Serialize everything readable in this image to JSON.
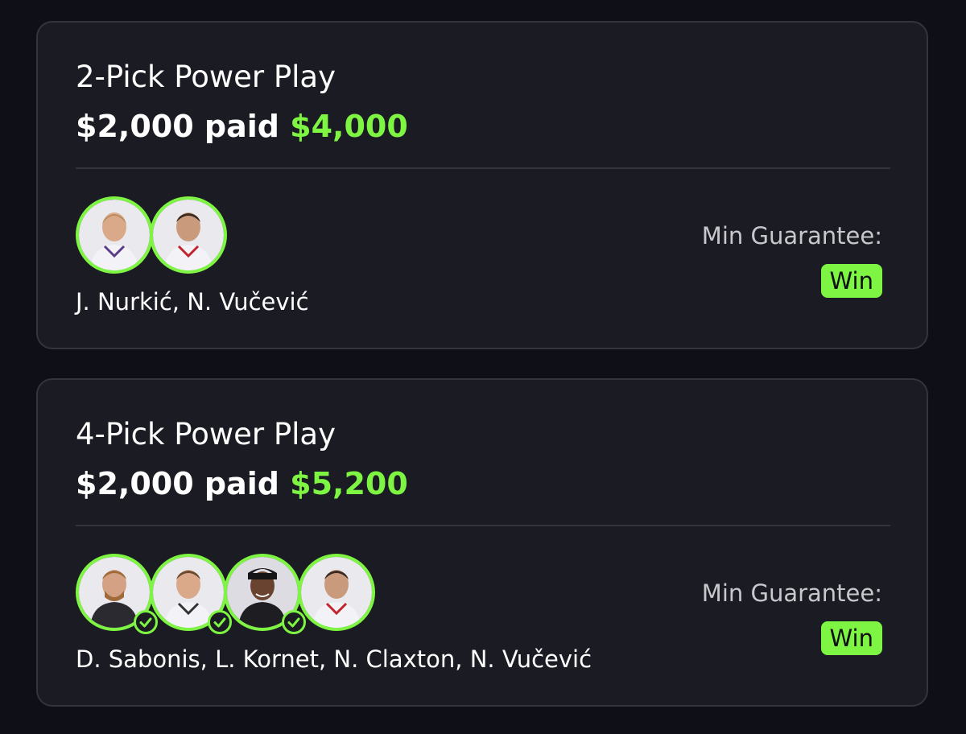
{
  "colors": {
    "accent": "#7ef542",
    "card_bg": "#1b1b23",
    "page_bg": "#0f0f18"
  },
  "cards": [
    {
      "title": "2-Pick Power Play",
      "paid_amount": "$2,000 paid",
      "payout": "$4,000",
      "players_text": "J. Nurkić, N. Vučević",
      "min_guarantee_label": "Min Guarantee:",
      "min_guarantee_value": "Win",
      "avatars": [
        {
          "icon": "player-headshot-icon",
          "checked": false
        },
        {
          "icon": "player-headshot-icon",
          "checked": false
        }
      ]
    },
    {
      "title": "4-Pick Power Play",
      "paid_amount": "$2,000 paid",
      "payout": "$5,200",
      "players_text": "D. Sabonis, L. Kornet, N. Claxton, N. Vučević",
      "min_guarantee_label": "Min Guarantee:",
      "min_guarantee_value": "Win",
      "avatars": [
        {
          "icon": "player-headshot-icon",
          "checked": true
        },
        {
          "icon": "player-headshot-icon",
          "checked": true
        },
        {
          "icon": "player-headshot-icon",
          "checked": true
        },
        {
          "icon": "player-headshot-icon",
          "checked": false
        }
      ]
    }
  ]
}
